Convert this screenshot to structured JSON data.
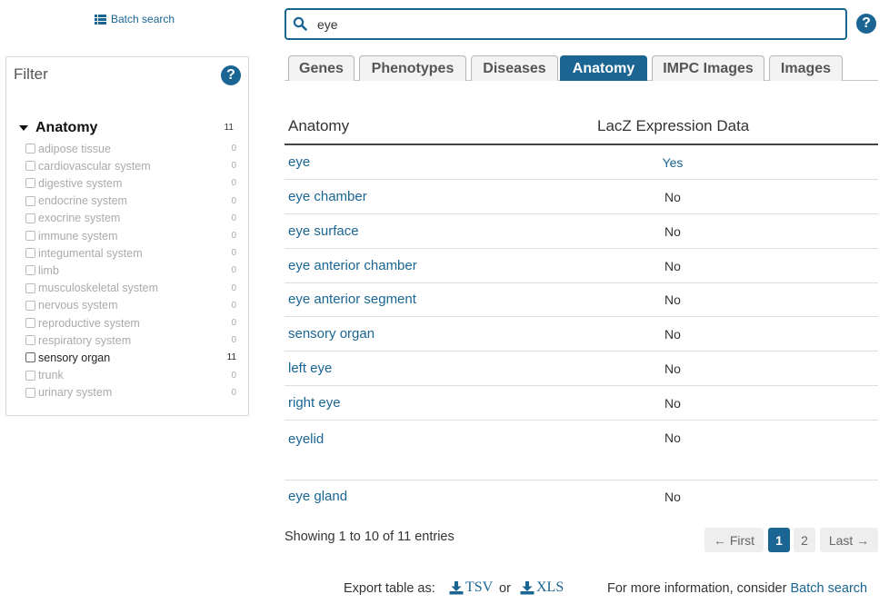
{
  "colors": {
    "accent": "#1a6592",
    "text": "#333333",
    "muted": "#aaaaaa"
  },
  "top": {
    "batch_search_label": "Batch search"
  },
  "search": {
    "value": "eye",
    "placeholder": ""
  },
  "filter": {
    "title": "Filter",
    "facet_label": "Anatomy",
    "facet_count": "11",
    "items": [
      {
        "label": "adipose tissue",
        "count": "0"
      },
      {
        "label": "cardiovascular system",
        "count": "0"
      },
      {
        "label": "digestive system",
        "count": "0"
      },
      {
        "label": "endocrine system",
        "count": "0"
      },
      {
        "label": "exocrine system",
        "count": "0"
      },
      {
        "label": "immune system",
        "count": "0"
      },
      {
        "label": "integumental system",
        "count": "0"
      },
      {
        "label": "limb",
        "count": "0"
      },
      {
        "label": "musculoskeletal system",
        "count": "0"
      },
      {
        "label": "nervous system",
        "count": "0"
      },
      {
        "label": "reproductive system",
        "count": "0"
      },
      {
        "label": "respiratory system",
        "count": "0"
      },
      {
        "label": "sensory organ",
        "count": "11"
      },
      {
        "label": "trunk",
        "count": "0"
      },
      {
        "label": "urinary system",
        "count": "0"
      }
    ]
  },
  "tabs": [
    {
      "label": "Genes"
    },
    {
      "label": "Phenotypes"
    },
    {
      "label": "Diseases"
    },
    {
      "label": "Anatomy",
      "active": true
    },
    {
      "label": "IMPC Images"
    },
    {
      "label": "Images"
    }
  ],
  "table": {
    "columns": [
      "Anatomy",
      "LacZ Expression Data"
    ],
    "rows": [
      {
        "term": "eye",
        "lacz": "Yes"
      },
      {
        "term": "eye chamber",
        "lacz": "No"
      },
      {
        "term": "eye surface",
        "lacz": "No"
      },
      {
        "term": "eye anterior chamber",
        "lacz": "No"
      },
      {
        "term": "eye anterior segment",
        "lacz": "No"
      },
      {
        "term": "sensory organ",
        "lacz": "No"
      },
      {
        "term": "left eye",
        "lacz": "No"
      },
      {
        "term": "right eye",
        "lacz": "No"
      },
      {
        "term": "eyelid",
        "lacz": "No"
      },
      {
        "term": "eye gland",
        "lacz": "No"
      }
    ]
  },
  "footer": {
    "entries_text": "Showing 1 to 10 of 11 entries",
    "pagination": {
      "first": "← First",
      "pages": [
        "1",
        "2"
      ],
      "current": "1",
      "last": "Last →"
    },
    "export_label": "Export table as:",
    "tsv": "TSV",
    "or": "or",
    "xls": "XLS",
    "more_info_prefix": "For more information, consider ",
    "more_info_link": "Batch search"
  }
}
